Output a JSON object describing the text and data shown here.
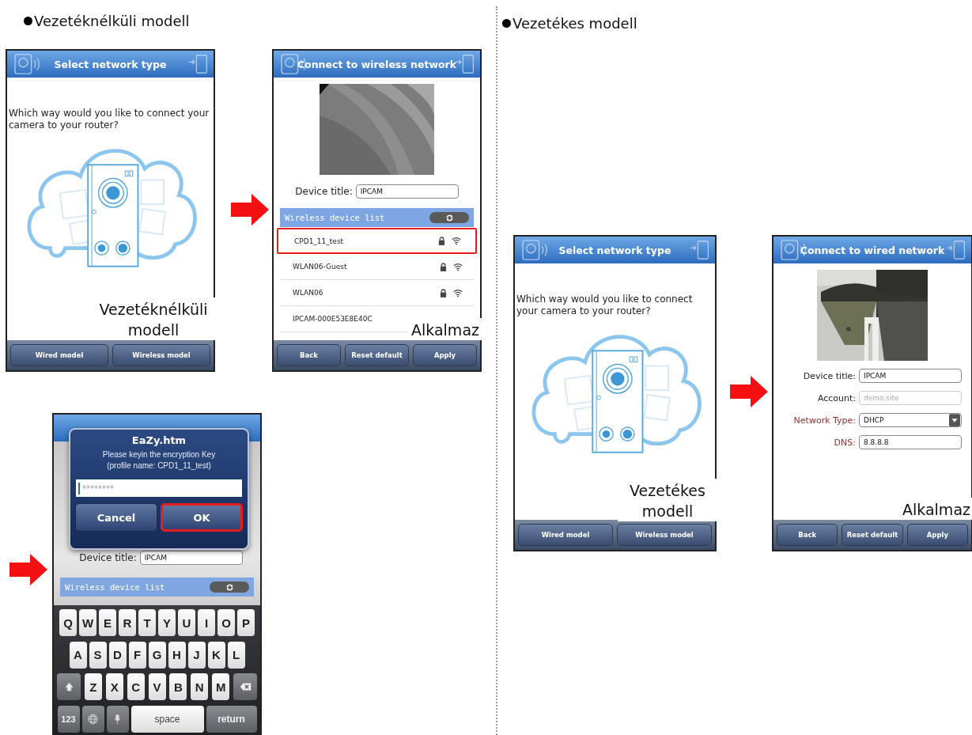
{
  "sections": [
    {
      "heading": "Vezetéknélküli modell",
      "screens": [
        {
          "kind": "select",
          "title": "Select network type",
          "question": "Which way would you like to connect your camera to your router?",
          "buttons": [
            "Wired model",
            "Wireless model"
          ],
          "callout": "Vezetéknélküli modell"
        },
        {
          "kind": "wireless",
          "title": "Connect to wireless network",
          "device_label": "Device title:",
          "device_value": "IPCAM",
          "list_title": "Wireless device list",
          "networks": [
            {
              "name": "CPD1_11_test",
              "highlighted": true,
              "locked": true
            },
            {
              "name": "WLAN06-Guest",
              "highlighted": false,
              "locked": true
            },
            {
              "name": "WLAN06",
              "highlighted": false,
              "locked": true
            },
            {
              "name": "IPCAM-000E53E8E40C",
              "highlighted": false,
              "locked": false
            }
          ],
          "buttons": [
            "Back",
            "Reset default",
            "Apply"
          ],
          "callout": "Alkalmaz"
        },
        {
          "kind": "key_dialog",
          "device_label": "Device title:",
          "device_value": "IPCAM",
          "list_title": "Wireless device list",
          "dialog": {
            "title": "EaZy.htm",
            "message": "Please keyin the encryption Key",
            "profile": "(profile name: CPD1_11_test)",
            "value": "********",
            "buttons": [
              {
                "label": "Cancel",
                "highlighted": false
              },
              {
                "label": "OK",
                "highlighted": true
              }
            ]
          },
          "keyboard": {
            "rows": [
              [
                "Q",
                "W",
                "E",
                "R",
                "T",
                "Y",
                "U",
                "I",
                "O",
                "P"
              ],
              [
                "A",
                "S",
                "D",
                "F",
                "G",
                "H",
                "J",
                "K",
                "L"
              ],
              [
                "Z",
                "X",
                "C",
                "V",
                "B",
                "N",
                "M"
              ]
            ],
            "mode_key": "123",
            "space_key": "space",
            "return_key": "return"
          }
        }
      ]
    },
    {
      "heading": "Vezetékes modell",
      "screens": [
        {
          "kind": "select",
          "title": "Select network type",
          "question": "Which way would you like to connect your camera to your router?",
          "buttons": [
            "Wired model",
            "Wireless model"
          ],
          "callout": "Vezetékes modell"
        },
        {
          "kind": "wired",
          "title": "Connect to wired network",
          "fields": [
            {
              "kind": "text",
              "label": "Device title:",
              "value": "IPCAM",
              "color": "#222222"
            },
            {
              "kind": "text",
              "label": "Account:",
              "placeholder": "demo.site",
              "color": "#222222"
            },
            {
              "kind": "select",
              "label": "Network Type:",
              "value": "DHCP",
              "color": "#8e2f2f"
            },
            {
              "kind": "text",
              "label": "DNS:",
              "value": "8.8.8.8",
              "color": "#8e2f2f"
            }
          ],
          "buttons": [
            "Back",
            "Reset default",
            "Apply"
          ],
          "callout": "Alkalmaz"
        }
      ]
    }
  ]
}
